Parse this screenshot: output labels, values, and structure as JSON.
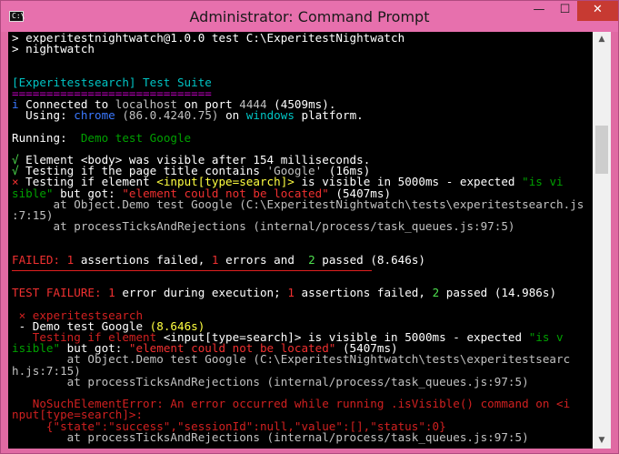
{
  "window": {
    "title": "Administrator: Command Prompt",
    "app_icon_text": "C:\\",
    "minimize_glyph": "—",
    "maximize_glyph": "☐",
    "close_glyph": "✕"
  },
  "scrollbar": {
    "up_glyph": "▲",
    "down_glyph": "▼",
    "position_fraction": 0.24
  },
  "console": {
    "lines": [
      [
        {
          "t": "> experitestnightwatch@1.0.0 test C:\\ExperitestNightwatch",
          "c": "w"
        }
      ],
      [
        {
          "t": "> nightwatch",
          "c": "w"
        }
      ],
      [
        {
          "t": "",
          "c": "g"
        }
      ],
      [
        {
          "t": "",
          "c": "g"
        }
      ],
      [
        {
          "t": "[Experitestsearch] Test Suite",
          "c": "c"
        }
      ],
      [
        {
          "t": "=============================",
          "c": "m"
        }
      ],
      [
        {
          "t": "i ",
          "c": "b"
        },
        {
          "t": "Connected to ",
          "c": "w"
        },
        {
          "t": "localhost",
          "c": "g"
        },
        {
          "t": " on port ",
          "c": "w"
        },
        {
          "t": "4444",
          "c": "g"
        },
        {
          "t": " (4509ms).",
          "c": "w"
        }
      ],
      [
        {
          "t": "  Using: ",
          "c": "w"
        },
        {
          "t": "chrome",
          "c": "b"
        },
        {
          "t": " (86.0.4240.75)",
          "c": "g"
        },
        {
          "t": " on ",
          "c": "w"
        },
        {
          "t": "windows",
          "c": "c"
        },
        {
          "t": " platform.",
          "c": "w"
        }
      ],
      [
        {
          "t": "",
          "c": "g"
        }
      ],
      [
        {
          "t": "Running:  ",
          "c": "w"
        },
        {
          "t": "Demo test Google",
          "c": "dg"
        }
      ],
      [
        {
          "t": "",
          "c": "g"
        }
      ],
      [
        {
          "t": "√ ",
          "c": "lg"
        },
        {
          "t": "Element <body> was visible after 154 milliseconds.",
          "c": "w"
        }
      ],
      [
        {
          "t": "√ ",
          "c": "lg"
        },
        {
          "t": "Testing if the page title contains ",
          "c": "w"
        },
        {
          "t": "'Google'",
          "c": "g"
        },
        {
          "t": " (16ms)",
          "c": "w"
        }
      ],
      [
        {
          "t": "× ",
          "c": "r"
        },
        {
          "t": "Testing if element ",
          "c": "w"
        },
        {
          "t": "<input[type=search]>",
          "c": "y"
        },
        {
          "t": " is visible in 5000ms - expected ",
          "c": "w"
        },
        {
          "t": "\"is vi",
          "c": "dg"
        }
      ],
      [
        {
          "t": "sible\"",
          "c": "dg"
        },
        {
          "t": " but got: ",
          "c": "w"
        },
        {
          "t": "\"element could not be located\"",
          "c": "r"
        },
        {
          "t": " (5407ms)",
          "c": "w"
        }
      ],
      [
        {
          "t": "      at Object.Demo test Google (C:\\ExperitestNightwatch\\tests\\experitestsearch.js",
          "c": "g"
        }
      ],
      [
        {
          "t": ":7:15)",
          "c": "g"
        }
      ],
      [
        {
          "t": "      at processTicksAndRejections (internal/process/task_queues.js:97:5)",
          "c": "g"
        }
      ],
      [
        {
          "t": "",
          "c": "g"
        }
      ],
      [
        {
          "t": "",
          "c": "g"
        }
      ],
      [
        {
          "t": "FAILED: ",
          "c": "r"
        },
        {
          "t": "1",
          "c": "r"
        },
        {
          "t": " assertions failed, ",
          "c": "w"
        },
        {
          "t": "1",
          "c": "r"
        },
        {
          "t": " errors and  ",
          "c": "w"
        },
        {
          "t": "2",
          "c": "lg"
        },
        {
          "t": " passed (8.646s)",
          "c": "w"
        }
      ],
      [
        {
          "t": "",
          "c": "g"
        }
      ],
      [
        {
          "t": "",
          "c": "g"
        }
      ],
      [
        {
          "t": "TEST FAILURE: ",
          "c": "r"
        },
        {
          "t": "1",
          "c": "r"
        },
        {
          "t": " error during execution; ",
          "c": "w"
        },
        {
          "t": "1",
          "c": "r"
        },
        {
          "t": " assertions failed, ",
          "c": "w"
        },
        {
          "t": "2",
          "c": "lg"
        },
        {
          "t": " passed (14.986s)",
          "c": "w"
        }
      ],
      [
        {
          "t": "",
          "c": "g"
        }
      ],
      [
        {
          "t": " × experitestsearch",
          "c": "dr"
        }
      ],
      [
        {
          "t": " - Demo test Google ",
          "c": "w"
        },
        {
          "t": "(8.646s)",
          "c": "y"
        }
      ],
      [
        {
          "t": "   Testing if element ",
          "c": "dr"
        },
        {
          "t": "<input[type=search]>",
          "c": "w"
        },
        {
          "t": " is visible in 5000ms - expected ",
          "c": "w"
        },
        {
          "t": "\"is v",
          "c": "dg"
        }
      ],
      [
        {
          "t": "isible\"",
          "c": "dg"
        },
        {
          "t": " but got: ",
          "c": "w"
        },
        {
          "t": "\"element could not be located\"",
          "c": "r"
        },
        {
          "t": " (5407ms)",
          "c": "w"
        }
      ],
      [
        {
          "t": "        at Object.Demo test Google (C:\\ExperitestNightwatch\\tests\\experitestsearc",
          "c": "g"
        }
      ],
      [
        {
          "t": "h.js:7:15)",
          "c": "g"
        }
      ],
      [
        {
          "t": "        at processTicksAndRejections (internal/process/task_queues.js:97:5)",
          "c": "g"
        }
      ],
      [
        {
          "t": "",
          "c": "g"
        }
      ],
      [
        {
          "t": "   NoSuchElementError: An error occurred while running .isVisible() command on <i",
          "c": "dr"
        }
      ],
      [
        {
          "t": "nput[type=search]>:",
          "c": "dr"
        }
      ],
      [
        {
          "t": "     {\"state\":\"success\",\"sessionId\":null,\"value\":[],\"status\":0}",
          "c": "dr"
        }
      ],
      [
        {
          "t": "        at processTicksAndRejections (internal/process/task_queues.js:97:5)",
          "c": "g"
        }
      ]
    ]
  }
}
